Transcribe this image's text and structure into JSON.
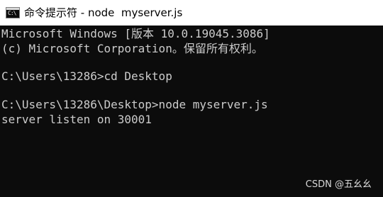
{
  "window": {
    "title": "命令提示符 - node  myserver.js",
    "icon": "console-app-icon",
    "icon_glyph": "C:\\"
  },
  "console": {
    "lines": [
      "Microsoft Windows [版本 10.0.19045.3086]",
      "(c) Microsoft Corporation。保留所有权利。",
      "C:\\Users\\13286>cd Desktop",
      "C:\\Users\\13286\\Desktop>node myserver.js",
      "server listen on 30001"
    ]
  },
  "watermark": "CSDN @五幺幺",
  "colors": {
    "titlebar_bg": "#ffffff",
    "console_bg": "#0c0c0c",
    "console_text": "#cccccc"
  }
}
